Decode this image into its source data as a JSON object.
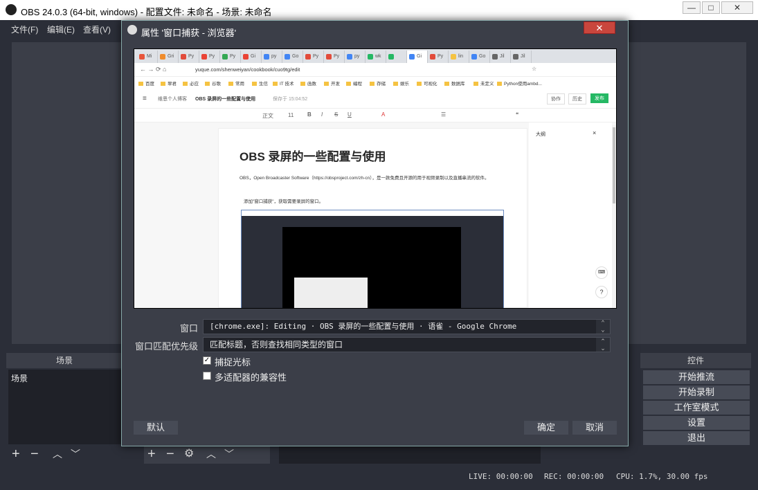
{
  "obs": {
    "title": "OBS 24.0.3 (64-bit, windows) - 配置文件: 未命名 - 场景: 未命名",
    "window_buttons": [
      "—",
      "□",
      "✕"
    ],
    "menu": [
      "文件(F)",
      "编辑(E)",
      "查看(V)"
    ],
    "scenes_header": "场景",
    "scenes_list_item": "场景",
    "controls_header": "控件",
    "controls": [
      "开始推流",
      "开始录制",
      "工作室模式",
      "设置",
      "退出"
    ],
    "status": {
      "live": "LIVE: 00:00:00",
      "rec": "REC: 00:00:00",
      "cpu": "CPU: 1.7%, 30.00 fps"
    }
  },
  "dialog": {
    "title": "属性 '窗口捕获 - 浏览器'",
    "close": "✕",
    "window_label": "窗口",
    "window_value": "[chrome.exe]: Editing · OBS 录屏的一些配置与使用 · 语雀 - Google Chrome",
    "priority_label": "窗口匹配优先级",
    "priority_value": "匹配标题，否则查找相同类型的窗口",
    "capture_cursor": {
      "label": "捕捉光标",
      "checked": true
    },
    "multi_adapter": {
      "label": "多适配器的兼容性",
      "checked": false
    },
    "defaults_button": "默认",
    "ok_button": "确定",
    "cancel_button": "取消"
  },
  "browser": {
    "tabs": [
      "Mi",
      "Gri",
      "Py",
      "Py",
      "Py",
      "Gi",
      "py",
      "Go",
      "Py",
      "Py",
      "py",
      "wk",
      "",
      "Gi",
      "Py",
      "lin",
      "Go",
      "Jil",
      "Jil"
    ],
    "url": "yuque.com/shenweiyan/cookbook/cuo9tg/edit",
    "bookmarks": [
      "百度",
      "翠君",
      "必应",
      "谷歌",
      "常用",
      "生信",
      "IT 技术",
      "函数",
      "开发",
      "编程",
      "存储",
      "娱乐",
      "可视化",
      "数据库",
      "未定义",
      "Python使用ambd..."
    ],
    "breadcrumb_parent": "维恩个人博客",
    "breadcrumb_doc": "OBS 录屏的一些配置与使用",
    "saved": "保存于 15:04:52",
    "collab": "协作",
    "history": "历史",
    "publish": "发布",
    "toolbar_text": "正文",
    "font_size": "11",
    "doc_title": "OBS 录屏的一些配置与使用",
    "para1": "OBS，Open Broadcaster Software（https://obsproject.com/zh-cn），是一款免费且开源的用于视频录制以及直播串流的软件。",
    "bullet1": "添加\"窗口捕获\"，获取需要录屏的窗口。",
    "outline": "大纲",
    "outline_close": "×"
  }
}
